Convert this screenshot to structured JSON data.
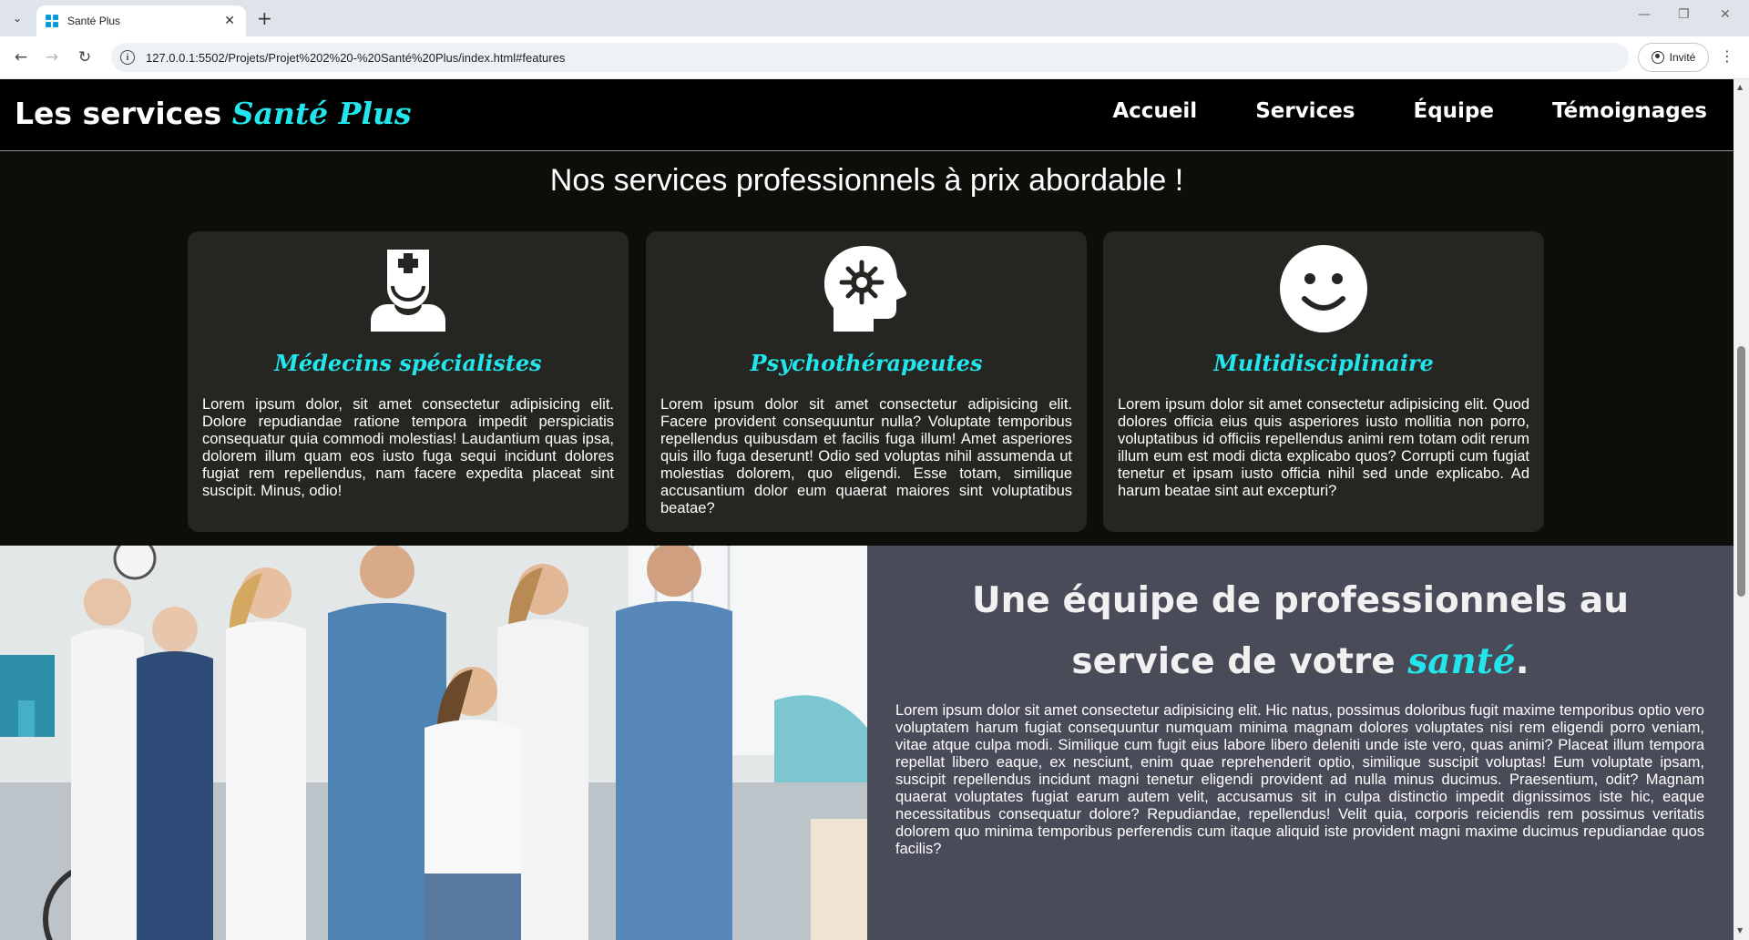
{
  "browser": {
    "tab_title": "Santé Plus",
    "url": "127.0.0.1:5502/Projets/Projet%202%20-%20Santé%20Plus/index.html#features",
    "profile_label": "Invité"
  },
  "header": {
    "logo_prefix": "Les services ",
    "logo_accent": "Santé Plus",
    "nav": [
      "Accueil",
      "Services",
      "Équipe",
      "Témoignages"
    ]
  },
  "features": {
    "title": "Nos services professionnels à prix abordable !",
    "cards": [
      {
        "icon": "doctor-icon",
        "title": "Médecins spécialistes",
        "text": "Lorem ipsum dolor, sit amet consectetur adipisicing elit. Dolore repudiandae ratione tempora impedit perspiciatis consequatur quia commodi molestias! Laudantium quas ipsa, dolorem illum quam eos iusto fuga sequi incidunt dolores fugiat rem repellendus, nam facere expedita placeat sint suscipit. Minus, odio!"
      },
      {
        "icon": "brain-virus-icon",
        "title": "Psychothérapeutes",
        "text": "Lorem ipsum dolor sit amet consectetur adipisicing elit. Facere provident consequuntur nulla? Voluptate temporibus repellendus quibusdam et facilis fuga illum! Amet asperiores quis illo fuga deserunt! Odio sed voluptas nihil assumenda ut molestias dolorem, quo eligendi. Esse totam, similique accusantium dolor eum quaerat maiores sint voluptatibus beatae?"
      },
      {
        "icon": "smiley-icon",
        "title": "Multidisciplinaire",
        "text": "Lorem ipsum dolor sit amet consectetur adipisicing elit. Quod dolores officia eius quis asperiores iusto mollitia non porro, voluptatibus id officiis repellendus animi rem totam odit rerum illum eum est modi dicta explicabo quos? Corrupti cum fugiat tenetur et ipsam iusto officia nihil sed unde explicabo. Ad harum beatae sint aut excepturi?"
      }
    ]
  },
  "team": {
    "title_line1": "Une équipe de professionnels au",
    "title_line2_prefix": "service de votre ",
    "title_accent": "santé",
    "title_suffix": ".",
    "body": "Lorem ipsum dolor sit amet consectetur adipisicing elit. Hic natus, possimus doloribus fugit maxime temporibus optio vero voluptatem harum fugiat consequuntur numquam minima magnam dolores voluptates nisi rem eligendi porro veniam, vitae atque culpa modi. Similique cum fugit eius labore libero deleniti unde iste vero, quas animi? Placeat illum tempora repellat libero eaque, ex nesciunt, enim quae reprehenderit optio, similique suscipit voluptas! Eum voluptate ipsam, suscipit repellendus incidunt magni tenetur eligendi provident ad nulla minus ducimus. Praesentium, odit? Magnam quaerat voluptates fugiat earum autem velit, accusamus sit in culpa distinctio impedit dignissimos iste hic, eaque necessitatibus consequatur dolore? Repudiandae, repellendus! Velit quia, corporis reiciendis rem possimus veritatis dolorem quo minima temporibus perferendis cum itaque aliquid iste provident magni maxime ducimus repudiandae quos facilis?"
  },
  "colors": {
    "accent": "#22e6ec",
    "header_bg": "#000000",
    "card_bg": "#252621",
    "team_panel_bg": "#4a4b58"
  }
}
